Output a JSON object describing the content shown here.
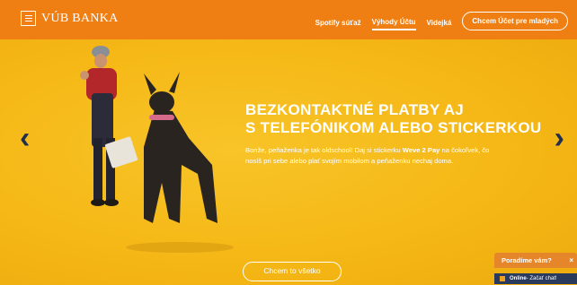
{
  "brand": {
    "logo_text": "VÚB BANKA"
  },
  "nav": {
    "items": [
      {
        "label": "Spotify súťaž",
        "active": false
      },
      {
        "label": "Výhody Účtu",
        "active": true
      },
      {
        "label": "Videjká",
        "active": false
      }
    ],
    "cta_label": "Chcem Účet pre mladých"
  },
  "hero": {
    "headline_line1": "BEZKONTAKTNÉ PLATBY AJ",
    "headline_line2": "S TELEFÓNIKOM ALEBO STICKERKOU",
    "sub_part1": "Bonže, peňaženka je tak oldschool! Daj si stickerku ",
    "sub_bold": "Weve 2 Pay",
    "sub_part2": " na čokoľvek, čo nosíš pri sebe alebo plať svojím mobilom a peňaženku nechaj doma.",
    "cta_label": "Chcem to všetko",
    "prev_arrow": "‹",
    "next_arrow": "›"
  },
  "chat": {
    "title": "Poradíme vám?",
    "close": "×",
    "status_bold": "Online",
    "status_text": " - Začať chat!"
  },
  "colors": {
    "topbar": "#f07f13",
    "hero_bg": "#f5b816",
    "arrow": "#1f2f4d",
    "chat_head": "#e5862a",
    "chat_body": "#2a3a5c"
  }
}
